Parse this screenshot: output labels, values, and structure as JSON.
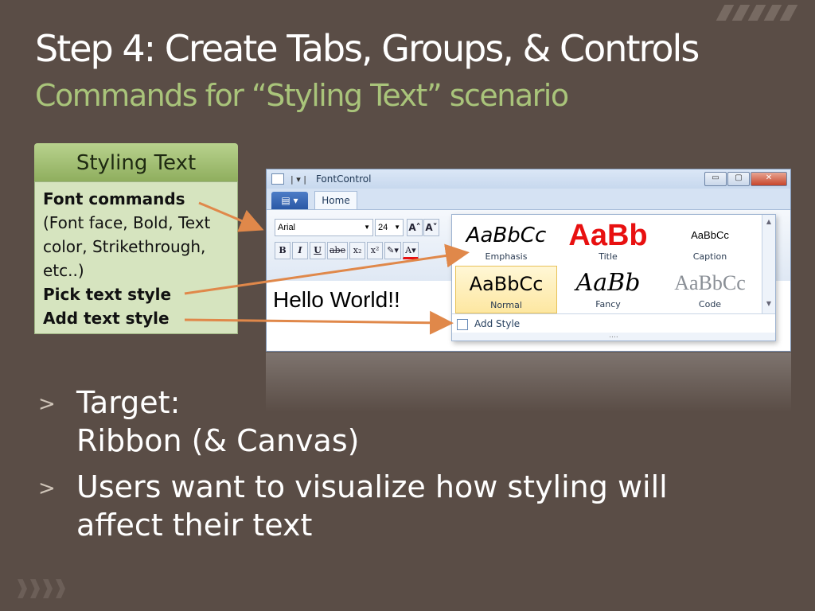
{
  "slide": {
    "title": "Step 4: Create Tabs, Groups, & Controls",
    "subtitle": "Commands for “Styling Text” scenario"
  },
  "callout": {
    "heading": "Styling Text",
    "font_commands": "Font commands",
    "font_detail": "(Font face, Bold, Text color, Strikethrough, etc..)",
    "pick_style": "Pick text style",
    "add_style": "Add text style"
  },
  "window": {
    "title": "FontControl",
    "controls": {
      "minimize": "▭",
      "maximize": "▢",
      "close": "✕"
    },
    "app_menu": "▤ ▾",
    "tab_home": "Home",
    "font_face": "Arial",
    "font_size": "24",
    "grow_font": "A˄",
    "shrink_font": "A˅",
    "format_buttons": [
      "B",
      "I",
      "U",
      "abe",
      "x₂",
      "x²",
      "✎▾",
      "A▾"
    ],
    "gallery": {
      "styles": [
        {
          "sample": "AaBbCc",
          "label": "Emphasis"
        },
        {
          "sample": "AaBb",
          "label": "Title"
        },
        {
          "sample": "AaBbCc",
          "label": "Caption"
        },
        {
          "sample": "AaBbCc",
          "label": "Normal"
        },
        {
          "sample": "AaBb",
          "label": "Fancy"
        },
        {
          "sample": "AaBbCc",
          "label": "Code"
        }
      ],
      "add_style": "Add Style",
      "grip": "....",
      "scroll_up": "▲",
      "scroll_down": "▼"
    },
    "canvas_text": "Hello World!!"
  },
  "bullets": {
    "marker": ">",
    "target_line1": "Target:",
    "target_line2": "Ribbon (& Canvas)",
    "users_line1": "Users want to visualize how styling will",
    "users_line2": "affect their text"
  },
  "colors": {
    "background": "#5a4d46",
    "subtitle": "#a9c47a",
    "arrow": "#e0884a",
    "title_style": "#e81010"
  }
}
